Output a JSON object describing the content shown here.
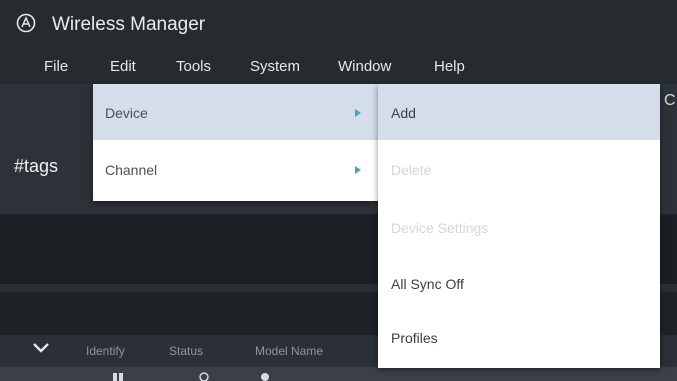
{
  "window": {
    "title": "Wireless Manager"
  },
  "menubar": {
    "items": [
      {
        "label": "File"
      },
      {
        "label": "Edit"
      },
      {
        "label": "Tools"
      },
      {
        "label": "System"
      },
      {
        "label": "Window"
      },
      {
        "label": "Help"
      }
    ]
  },
  "sidebar": {
    "tags_label": "#tags"
  },
  "edge_glyph": "C",
  "edit_menu": {
    "items": [
      {
        "label": "Device",
        "has_submenu": true,
        "highlighted": true
      },
      {
        "label": "Channel",
        "has_submenu": true,
        "highlighted": false
      }
    ]
  },
  "device_submenu": {
    "items": [
      {
        "label": "Add",
        "enabled": true,
        "highlighted": true
      },
      {
        "label": "Delete",
        "enabled": false
      },
      {
        "label": "Device Settings",
        "enabled": false
      },
      {
        "label": "All Sync Off",
        "enabled": true
      },
      {
        "label": "Profiles",
        "enabled": true
      }
    ]
  },
  "table": {
    "columns": [
      "Identify",
      "Status",
      "Model Name"
    ]
  },
  "colors": {
    "titlebar": "#262b30",
    "menu_bg": "#ffffff",
    "highlight": "#d4deea",
    "submenu_arrow": "#4aa3b8"
  }
}
